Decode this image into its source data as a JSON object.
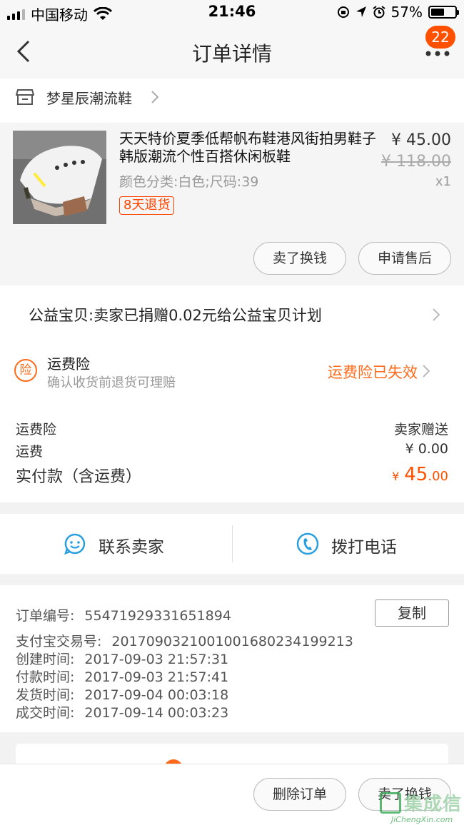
{
  "status_bar": {
    "carrier": "中国移动",
    "time": "21:46",
    "battery": "57%",
    "battery_level": 0.57
  },
  "nav": {
    "title": "订单详情",
    "badge": "22"
  },
  "shop": {
    "name": "梦星辰潮流鞋"
  },
  "product": {
    "title": "天天特价夏季低帮帆布鞋港风街拍男鞋子韩版潮流个性百搭休闲板鞋",
    "sku": "颜色分类:白色;尺码:39",
    "tag": "8天退货",
    "price": "¥ 45.00",
    "original_price": "¥ 118.00",
    "quantity": "x1",
    "sell_button": "卖了换钱",
    "aftersale_button": "申请售后"
  },
  "charity": {
    "text": "公益宝贝:卖家已捐赠0.02元给公益宝贝计划"
  },
  "insurance": {
    "icon_char": "险",
    "title": "运费险",
    "subtitle": "确认收货前退货可理赔",
    "status": "运费险已失效"
  },
  "fees": {
    "insurance_label": "运费险",
    "insurance_value": "卖家赠送",
    "shipping_label": "运费",
    "shipping_value": "¥ 0.00",
    "paid_label": "实付款（含运费）",
    "paid_symbol": "¥",
    "paid_integer": "45",
    "paid_decimal": ".00"
  },
  "contact": {
    "seller_label": "联系卖家",
    "call_label": "拨打电话"
  },
  "order_info": {
    "order_no_label": "订单编号:",
    "order_no": "55471929331651894",
    "copy_button": "复制",
    "alipay_label": "支付宝交易号:",
    "alipay_no": "2017090321001001680234199213",
    "created_label": "创建时间:",
    "created": "2017-09-03 21:57:31",
    "paid_label": "付款时间:",
    "paid": "2017-09-03 21:57:41",
    "shipped_label": "发货时间:",
    "shipped": "2017-09-04 00:03:18",
    "completed_label": "成交时间:",
    "completed": "2017-09-14 00:03:23"
  },
  "bottom": {
    "delete_button": "删除订单",
    "sell_button": "卖了换钱"
  },
  "watermark": {
    "text": "集成信",
    "url": "JiChengXin.com"
  },
  "colors": {
    "accent": "#ff5000",
    "orange": "#ff6a1a",
    "blue": "#2a9fe0"
  }
}
